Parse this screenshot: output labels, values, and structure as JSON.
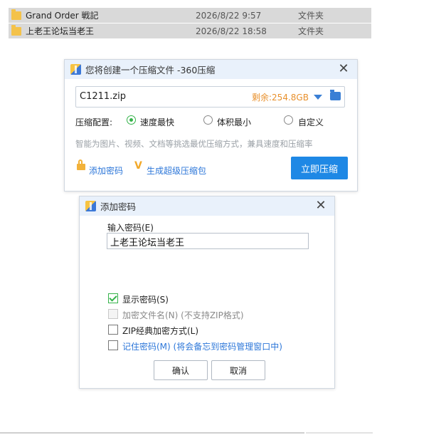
{
  "files": [
    {
      "name": "Grand Order 戦記",
      "date": "2026/8/22 9:57",
      "type": "文件夹"
    },
    {
      "name": "上老王论坛当老王",
      "date": "2026/8/22 18:58",
      "type": "文件夹"
    }
  ],
  "compress_dialog": {
    "title": "您将创建一个压缩文件 -360压缩",
    "filename": "C1211.zip",
    "free_space": "剩余:254.8GB",
    "config_label": "压缩配置:",
    "options": [
      {
        "label": "速度最快",
        "selected": true
      },
      {
        "label": "体积最小",
        "selected": false
      },
      {
        "label": "自定义",
        "selected": false
      }
    ],
    "hint": "智能为图片、视频、文档等挑选最优压缩方式，兼具速度和压缩率",
    "add_password": "添加密码",
    "super_package": "生成超级压缩包",
    "compress_button": "立即压缩"
  },
  "password_dialog": {
    "title": "添加密码",
    "input_label": "输入密码(E)",
    "password_value": "上老王论坛当老王",
    "checkboxes": [
      {
        "label": "显示密码(S)",
        "checked": true,
        "disabled": false
      },
      {
        "label": "加密文件名(N) (不支持ZIP格式)",
        "checked": false,
        "disabled": true
      },
      {
        "label": "ZIP经典加密方式(L)",
        "checked": false,
        "disabled": false
      },
      {
        "label": "记住密码(M) (将会备忘到密码管理窗口中)",
        "checked": false,
        "disabled": false
      }
    ],
    "ok_button": "确认",
    "cancel_button": "取消"
  },
  "colors": {
    "accent": "#1e88e5",
    "free_space": "#e8902c",
    "check_green": "#35b34a",
    "link_blue": "#2d77d9"
  }
}
